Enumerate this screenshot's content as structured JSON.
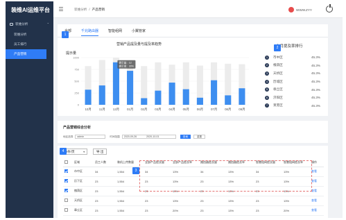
{
  "app": {
    "title": "装维AI运维平台"
  },
  "sidebar": {
    "group_label": "装维分析",
    "items": [
      {
        "label": "装维分析",
        "active": false
      },
      {
        "label": "员工排行",
        "active": false
      },
      {
        "label": "产品营销",
        "active": true
      }
    ]
  },
  "header": {
    "breadcrumb": [
      "装维分析",
      "产品营销"
    ],
    "username": "WWW.ZYY"
  },
  "tabs": [
    {
      "label": "全部",
      "active": false
    },
    {
      "label": "千兆路由器",
      "active": true
    },
    {
      "label": "智能组网",
      "active": false
    },
    {
      "label": "小翼管家",
      "active": false
    }
  ],
  "markers": [
    "1",
    "2",
    "3",
    "4"
  ],
  "chart_data": {
    "type": "bar",
    "title": "营销产品提及量与提及率趋势",
    "ylabel": "提示量",
    "categories": [
      "10月",
      "11月",
      "12月",
      "01月",
      "02月",
      "03月",
      "04月",
      "05月",
      "06月",
      "07月",
      "08月",
      "09月"
    ],
    "ylim": [
      0,
      1000
    ],
    "yticks": [
      0,
      250,
      500,
      750,
      1000
    ],
    "series": [
      {
        "name": "提示量",
        "color": "#3d8ef0",
        "values": [
          320,
          410,
          900,
          720,
          140,
          300,
          470,
          330,
          150,
          520,
          200,
          350
        ]
      },
      {
        "name": "total",
        "color": "#ececec",
        "values": [
          820,
          950,
          1000,
          850,
          820,
          900,
          850,
          900,
          830,
          900,
          870,
          860
        ]
      }
    ],
    "tooltip": {
      "line1": "提示量：12",
      "line2": "提示率：30%"
    }
  },
  "ranking": {
    "title": "本月提及率排行",
    "items": [
      {
        "rank": "1",
        "name": "市中区",
        "value": "45.3%"
      },
      {
        "rank": "2",
        "name": "槐荫区",
        "value": "45.3%"
      },
      {
        "rank": "3",
        "name": "天桥区",
        "value": "45.3%"
      },
      {
        "rank": "4",
        "name": "历城区",
        "value": "45.3%"
      },
      {
        "rank": "5",
        "name": "章丘区",
        "value": "45.3%"
      },
      {
        "rank": "6",
        "name": "济阳区",
        "value": "45.3%"
      },
      {
        "rank": "7",
        "name": "莱芜区",
        "value": "45.3%"
      }
    ]
  },
  "filters": {
    "title": "产品营销综合分析",
    "area_label": "地区选择",
    "area_value": "admin",
    "time_label": "时间范围",
    "date_from": "2020-09-26",
    "date_to": "2020-10-01",
    "search_label": "查询",
    "reset_label": "重置"
  },
  "table": {
    "page_size": "10条/页",
    "export_label": "导 出",
    "columns": [
      "区域",
      "员工人数",
      "装机上传数量",
      "全部产品提及量",
      "全部产品提及率",
      "路由器提及量",
      "路由器提及率",
      "智慧组网提及量",
      "智慧组网提及率",
      "操作"
    ],
    "rows": [
      {
        "checked": true,
        "cells": [
          "市中区",
          "34",
          "1,554",
          "34",
          "13%",
          "34",
          "13%",
          "34",
          "13%"
        ],
        "action": "查看"
      },
      {
        "checked": true,
        "cells": [
          "历下区",
          "23",
          "1,554",
          "23",
          "13%",
          "23",
          "13%",
          "23",
          "13%"
        ],
        "action": "查看"
      },
      {
        "checked": true,
        "cells": [
          "槐荫区",
          "23",
          "1,554",
          "23",
          "13%",
          "23",
          "13%",
          "23",
          "13%"
        ],
        "action": "查看"
      },
      {
        "checked": false,
        "cells": [
          "天桥区",
          "23",
          "1,554",
          "23",
          "13%",
          "23",
          "13%",
          "23",
          "13%"
        ],
        "action": "查看"
      },
      {
        "checked": false,
        "cells": [
          "章丘区",
          "23",
          "1,554",
          "23",
          "20%",
          "23",
          "13%",
          "23",
          "20%"
        ],
        "action": "查看"
      }
    ]
  }
}
